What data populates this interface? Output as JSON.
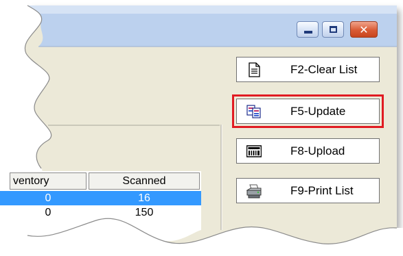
{
  "window": {
    "minimize_icon": "minimize-icon",
    "maximize_icon": "maximize-icon",
    "close_icon": "close-icon",
    "colors": {
      "titlebar": "#bcd1ee",
      "panel": "#ece9d8",
      "close": "#d95b35"
    }
  },
  "actions": {
    "clear": {
      "label": "F2-Clear List",
      "icon": "document-icon"
    },
    "update": {
      "label": "F5-Update",
      "icon": "refresh-icon",
      "highlight_color": "#e11b22"
    },
    "upload": {
      "label": "F8-Upload",
      "icon": "upload-icon"
    },
    "print": {
      "label": "F9-Print List",
      "icon": "printer-icon"
    }
  },
  "grid": {
    "columns": [
      "ventory",
      "Scanned"
    ],
    "rows": [
      {
        "inventory": "0",
        "scanned": "16",
        "selected": true
      },
      {
        "inventory": "0",
        "scanned": "150",
        "selected": false
      }
    ],
    "selection_color": "#3399ff"
  }
}
